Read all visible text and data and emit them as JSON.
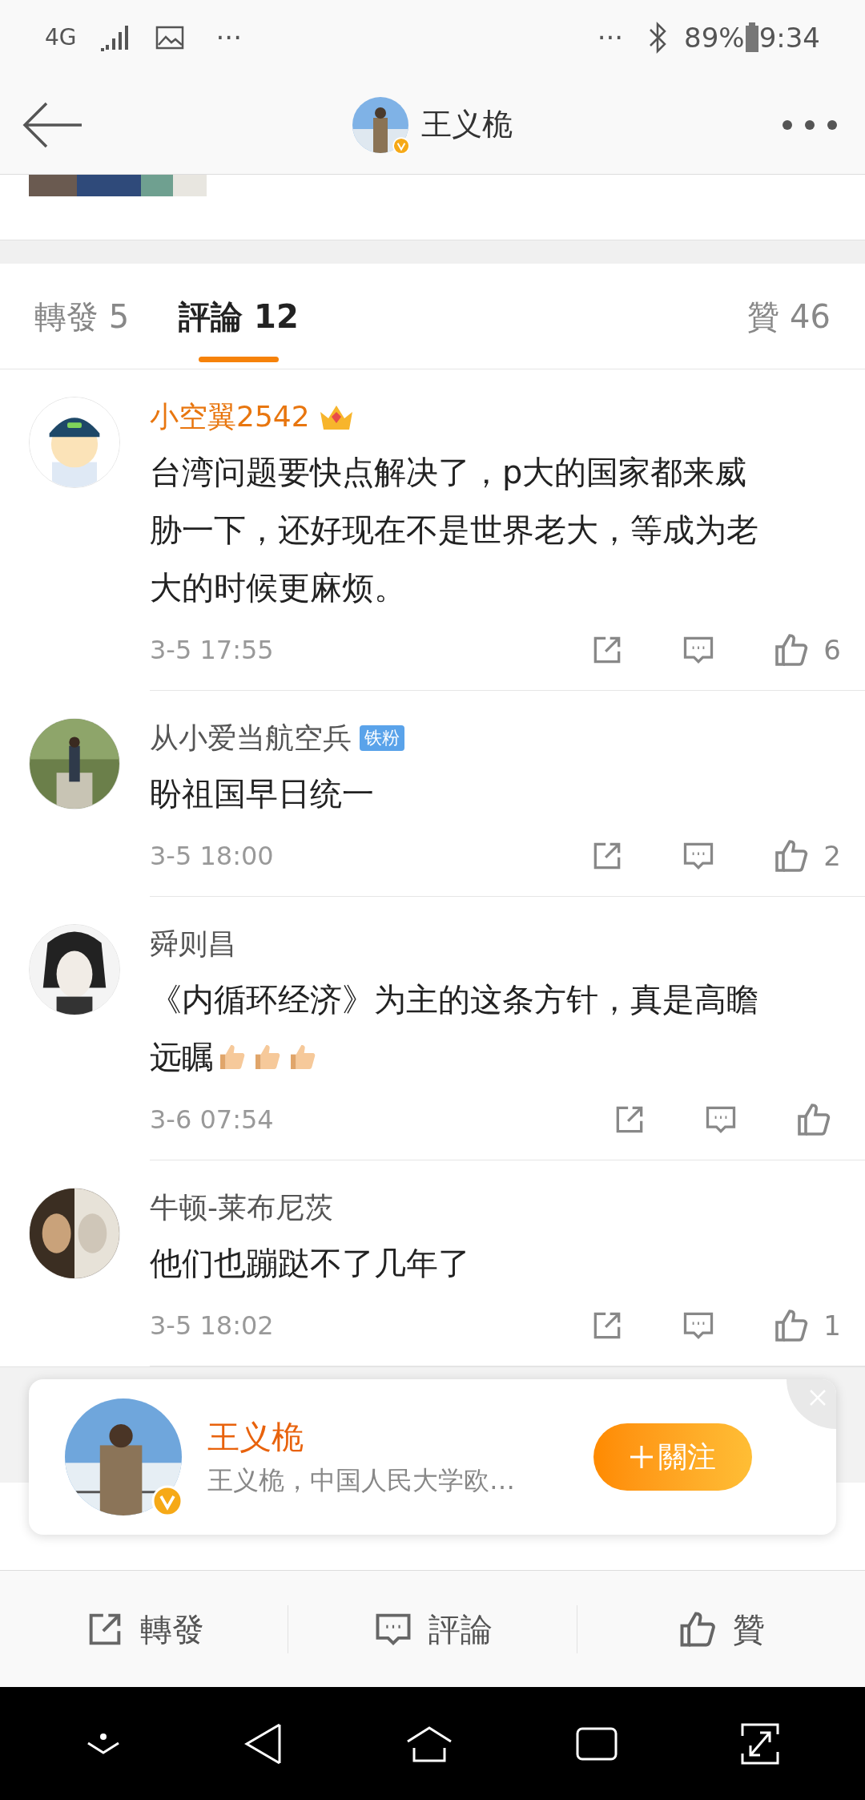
{
  "status_bar": {
    "network": "4G",
    "left_more": "···",
    "right_more": "···",
    "battery": "89%",
    "time": "9:34"
  },
  "header": {
    "title": "王义桅",
    "verified": true
  },
  "tabs": [
    {
      "label": "轉發 5",
      "selected": false
    },
    {
      "label": "評論 12",
      "selected": true
    },
    {
      "label": "贊 46",
      "selected": false
    }
  ],
  "comments": [
    {
      "user": "小空翼2542",
      "member": true,
      "crown": true,
      "lines": [
        "台湾问题要快点解决了，p大的国家都来威",
        "胁一下，还好现在不是世界老大，等成为老",
        "大的时候更麻烦。"
      ],
      "time": "3-5 17:55",
      "likes": "6"
    },
    {
      "user": "从小爱当航空兵",
      "member": false,
      "crown": false,
      "badge": "铁粉",
      "lines": [
        "盼祖国早日统一"
      ],
      "time": "3-5 18:00",
      "likes": "2"
    },
    {
      "user": "舜则昌",
      "member": false,
      "crown": false,
      "lines": [
        "《内循环经济》为主的这条方针，真是高瞻",
        "远瞩"
      ],
      "emojis": [
        {
          "kind": "thumbs_up"
        },
        {
          "kind": "thumbs_up"
        },
        {
          "kind": "thumbs_up"
        }
      ],
      "time": "3-6 07:54"
    },
    {
      "user": "牛顿-莱布尼茨",
      "member": false,
      "crown": false,
      "lines": [
        "他们也蹦跶不了几年了"
      ],
      "time": "3-5 18:02",
      "likes": "1"
    }
  ],
  "follow_card": {
    "name": "王义桅",
    "verified": true,
    "description": "王义桅，中国人民大学欧…",
    "button": "關注"
  },
  "actions": [
    {
      "kind": "repost",
      "label": "轉發"
    },
    {
      "kind": "comment",
      "label": "評論"
    },
    {
      "kind": "like",
      "label": "贊"
    }
  ]
}
